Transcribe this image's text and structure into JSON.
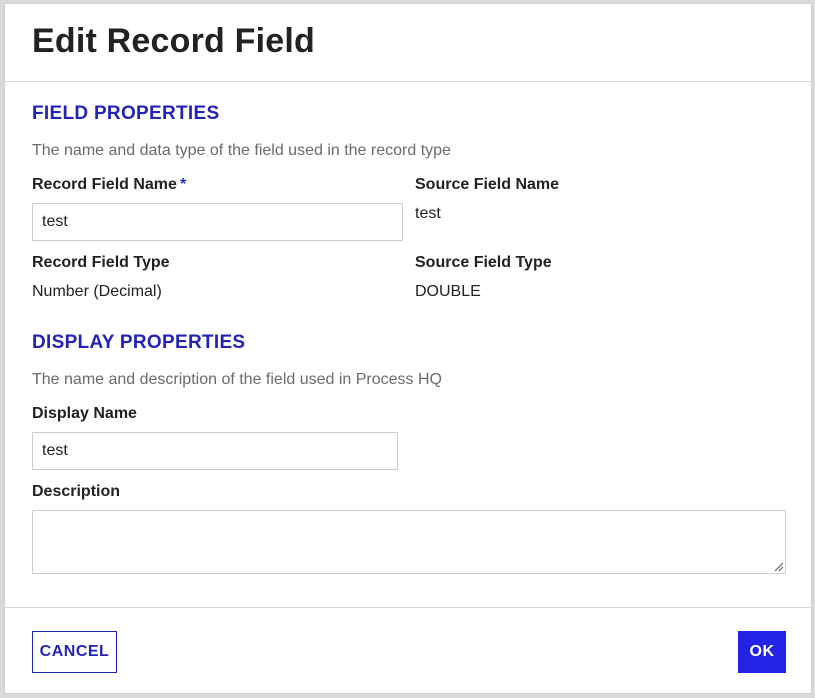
{
  "dialog": {
    "title": "Edit Record Field"
  },
  "field_properties": {
    "heading": "FIELD PROPERTIES",
    "description": "The name and data type of the field used in the record type",
    "record_field_name_label": "Record Field Name",
    "required_marker": "*",
    "record_field_name_value": "test",
    "source_field_name_label": "Source Field Name",
    "source_field_name_value": "test",
    "record_field_type_label": "Record Field Type",
    "record_field_type_value": "Number (Decimal)",
    "source_field_type_label": "Source Field Type",
    "source_field_type_value": "DOUBLE"
  },
  "display_properties": {
    "heading": "DISPLAY PROPERTIES",
    "description": "The name and description of the field used in Process HQ",
    "display_name_label": "Display Name",
    "display_name_value": "test",
    "description_label": "Description",
    "description_value": ""
  },
  "footer": {
    "cancel_label": "CANCEL",
    "ok_label": "OK"
  },
  "colors": {
    "accent": "#2323b8",
    "primary_button": "#2323e6"
  },
  "icons": {
    "textarea_resize": "resize-grip-icon"
  }
}
